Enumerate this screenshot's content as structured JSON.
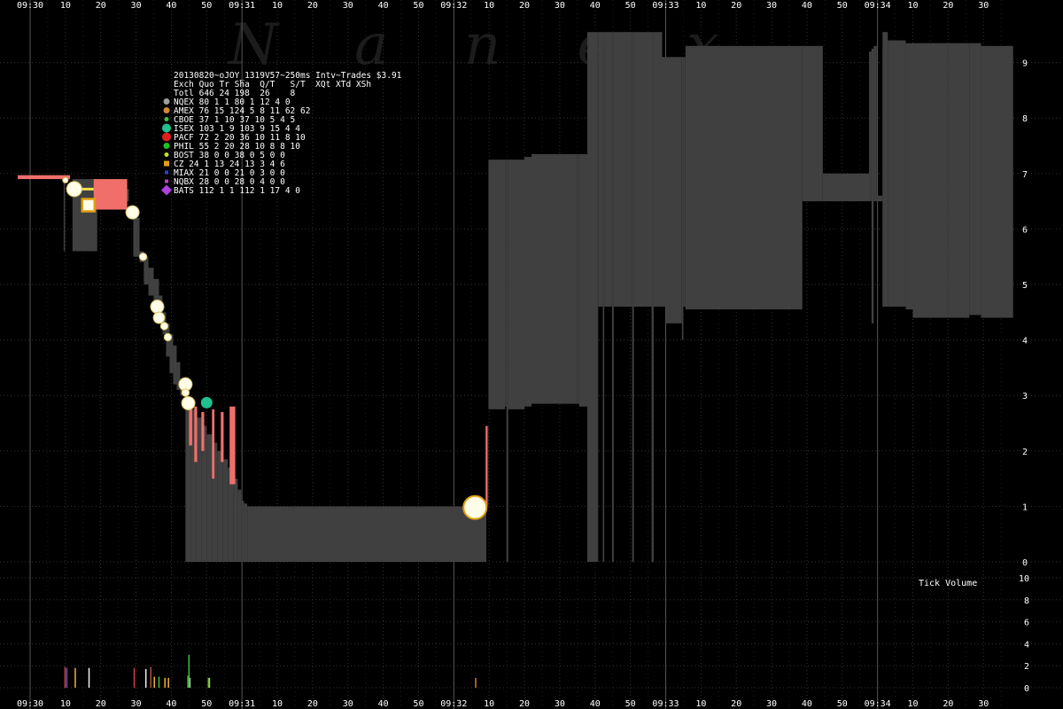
{
  "chart_data": {
    "type": "area",
    "title": "20130820~oJOY_1319V57~250ms Intv~Trades $3.91",
    "watermark": "Nanex",
    "x_axis": {
      "start": "09:30:00",
      "end": "09:34:38",
      "tick_labels": [
        {
          "t": 0,
          "label": "09:30"
        },
        {
          "t": 10,
          "label": "10"
        },
        {
          "t": 20,
          "label": "20"
        },
        {
          "t": 30,
          "label": "30"
        },
        {
          "t": 40,
          "label": "40"
        },
        {
          "t": 50,
          "label": "50"
        },
        {
          "t": 60,
          "label": "09:31"
        },
        {
          "t": 70,
          "label": "10"
        },
        {
          "t": 80,
          "label": "20"
        },
        {
          "t": 90,
          "label": "30"
        },
        {
          "t": 100,
          "label": "40"
        },
        {
          "t": 110,
          "label": "50"
        },
        {
          "t": 120,
          "label": "09:32"
        },
        {
          "t": 130,
          "label": "10"
        },
        {
          "t": 140,
          "label": "20"
        },
        {
          "t": 150,
          "label": "30"
        },
        {
          "t": 160,
          "label": "40"
        },
        {
          "t": 170,
          "label": "50"
        },
        {
          "t": 180,
          "label": "09:33"
        },
        {
          "t": 190,
          "label": "10"
        },
        {
          "t": 200,
          "label": "20"
        },
        {
          "t": 210,
          "label": "30"
        },
        {
          "t": 220,
          "label": "40"
        },
        {
          "t": 230,
          "label": "50"
        },
        {
          "t": 240,
          "label": "09:34"
        },
        {
          "t": 250,
          "label": "10"
        },
        {
          "t": 260,
          "label": "20"
        },
        {
          "t": 270,
          "label": "30"
        }
      ]
    },
    "price_axis": {
      "ylim": [
        0,
        9.5
      ],
      "ticks": [
        0,
        1,
        2,
        3,
        4,
        5,
        6,
        7,
        8,
        9
      ]
    },
    "volume_axis": {
      "label": "Tick Volume",
      "ylim": [
        0,
        10
      ],
      "ticks": [
        0,
        2,
        4,
        6,
        8,
        10
      ]
    },
    "grid": true,
    "colors": {
      "background": "#000000",
      "spread": "#404040",
      "crossed": "#f06f6a",
      "grid": "#333333",
      "minute_line": "#555555",
      "text": "#ffffff"
    },
    "spread_series": [
      {
        "t": 12.0,
        "bid": 5.6,
        "ask": 6.9
      },
      {
        "t": 19.0,
        "bid": 6.5,
        "ask": 6.72
      },
      {
        "t": 28.0,
        "bid": 6.3,
        "ask": 6.35
      },
      {
        "t": 29.2,
        "bid": 5.5,
        "ask": 6.2
      },
      {
        "t": 31.0,
        "bid": 5.4,
        "ask": 5.6
      },
      {
        "t": 32.2,
        "bid": 5.0,
        "ask": 5.5
      },
      {
        "t": 33.5,
        "bid": 4.8,
        "ask": 5.3
      },
      {
        "t": 35.0,
        "bid": 4.5,
        "ask": 5.1
      },
      {
        "t": 36.5,
        "bid": 4.3,
        "ask": 4.8
      },
      {
        "t": 37.5,
        "bid": 4.1,
        "ask": 4.5
      },
      {
        "t": 38.5,
        "bid": 3.7,
        "ask": 4.3
      },
      {
        "t": 39.5,
        "bid": 3.4,
        "ask": 4.1
      },
      {
        "t": 40.5,
        "bid": 3.2,
        "ask": 3.9
      },
      {
        "t": 41.5,
        "bid": 3.1,
        "ask": 3.6
      },
      {
        "t": 42.5,
        "bid": 3.0,
        "ask": 3.3
      },
      {
        "t": 44.0,
        "bid": 0.0,
        "ask": 2.9
      },
      {
        "t": 45.5,
        "bid": 0.0,
        "ask": 2.75
      },
      {
        "t": 47.0,
        "bid": 0.0,
        "ask": 2.6
      },
      {
        "t": 48.5,
        "bid": 0.0,
        "ask": 2.45
      },
      {
        "t": 50.0,
        "bid": 0.0,
        "ask": 2.3
      },
      {
        "t": 51.5,
        "bid": 0.0,
        "ask": 2.15
      },
      {
        "t": 53.0,
        "bid": 0.0,
        "ask": 2.0
      },
      {
        "t": 54.5,
        "bid": 0.0,
        "ask": 1.85
      },
      {
        "t": 56.0,
        "bid": 0.0,
        "ask": 1.7
      },
      {
        "t": 57.5,
        "bid": 0.0,
        "ask": 1.5
      },
      {
        "t": 58.8,
        "bid": 0.0,
        "ask": 1.3
      },
      {
        "t": 59.8,
        "bid": 0.0,
        "ask": 1.1
      },
      {
        "t": 60.6,
        "bid": 0.0,
        "ask": 1.05
      },
      {
        "t": 61.5,
        "bid": 0.0,
        "ask": 1.0
      },
      {
        "t": 128.7,
        "bid": 0.0,
        "ask": 1.0
      },
      {
        "t": 129.2,
        "bid": 1.0,
        "ask": 2.45
      },
      {
        "t": 129.8,
        "bid": 2.75,
        "ask": 7.25
      },
      {
        "t": 134.5,
        "bid": 2.8,
        "ask": 7.25
      },
      {
        "t": 134.9,
        "bid": 0.0,
        "ask": 7.25
      },
      {
        "t": 135.4,
        "bid": 2.75,
        "ask": 7.25
      },
      {
        "t": 140.0,
        "bid": 2.8,
        "ask": 7.3
      },
      {
        "t": 142.0,
        "bid": 2.85,
        "ask": 7.35
      },
      {
        "t": 155.0,
        "bid": 2.85,
        "ask": 7.35
      },
      {
        "t": 155.5,
        "bid": 2.8,
        "ask": 7.35
      },
      {
        "t": 157.8,
        "bid": 0.0,
        "ask": 9.55
      },
      {
        "t": 160.7,
        "bid": 0.0,
        "ask": 9.55
      },
      {
        "t": 160.9,
        "bid": 4.6,
        "ask": 9.55
      },
      {
        "t": 162.2,
        "bid": 0.0,
        "ask": 9.55
      },
      {
        "t": 162.6,
        "bid": 4.6,
        "ask": 9.55
      },
      {
        "t": 164.8,
        "bid": 0.0,
        "ask": 9.55
      },
      {
        "t": 165.3,
        "bid": 4.6,
        "ask": 9.55
      },
      {
        "t": 170.5,
        "bid": 0.0,
        "ask": 9.55
      },
      {
        "t": 171.0,
        "bid": 4.6,
        "ask": 9.55
      },
      {
        "t": 176.0,
        "bid": 0.0,
        "ask": 9.55
      },
      {
        "t": 176.6,
        "bid": 4.6,
        "ask": 9.55
      },
      {
        "t": 179.0,
        "bid": 4.6,
        "ask": 9.1
      },
      {
        "t": 180.0,
        "bid": 4.3,
        "ask": 9.1
      },
      {
        "t": 184.6,
        "bid": 4.0,
        "ask": 9.1
      },
      {
        "t": 185.0,
        "bid": 4.6,
        "ask": 9.1
      },
      {
        "t": 185.6,
        "bid": 4.55,
        "ask": 9.3
      },
      {
        "t": 218.7,
        "bid": 6.5,
        "ask": 9.3
      },
      {
        "t": 224.5,
        "bid": 6.5,
        "ask": 7.0
      },
      {
        "t": 237.6,
        "bid": 6.5,
        "ask": 9.2
      },
      {
        "t": 238.3,
        "bid": 4.3,
        "ask": 9.25
      },
      {
        "t": 238.9,
        "bid": 6.5,
        "ask": 9.3
      },
      {
        "t": 239.8,
        "bid": 6.5,
        "ask": 6.6
      },
      {
        "t": 241.4,
        "bid": 4.6,
        "ask": 9.55
      },
      {
        "t": 242.9,
        "bid": 4.6,
        "ask": 9.4
      },
      {
        "t": 248.0,
        "bid": 4.55,
        "ask": 9.35
      },
      {
        "t": 250.0,
        "bid": 4.4,
        "ask": 9.35
      },
      {
        "t": 260.0,
        "bid": 4.4,
        "ask": 9.35
      },
      {
        "t": 266.0,
        "bid": 4.45,
        "ask": 9.35
      },
      {
        "t": 269.3,
        "bid": 4.4,
        "ask": 9.3
      },
      {
        "t": 278.4,
        "bid": 4.4,
        "ask": 9.3
      }
    ],
    "crossed_bars": [
      {
        "t0": -3.5,
        "t1": 11.3,
        "lo": 6.9,
        "hi": 6.97
      },
      {
        "t0": 18.0,
        "t1": 27.5,
        "lo": 6.35,
        "hi": 6.9
      },
      {
        "t0": 45.0,
        "t1": 45.9,
        "lo": 2.1,
        "hi": 2.9
      },
      {
        "t0": 46.5,
        "t1": 47.3,
        "lo": 1.8,
        "hi": 2.8
      },
      {
        "t0": 48.5,
        "t1": 49.3,
        "lo": 2.0,
        "hi": 2.7
      },
      {
        "t0": 51.5,
        "t1": 52.2,
        "lo": 1.5,
        "hi": 2.75
      },
      {
        "t0": 54.0,
        "t1": 54.8,
        "lo": 1.8,
        "hi": 2.7
      },
      {
        "t0": 56.5,
        "t1": 58.1,
        "lo": 1.4,
        "hi": 2.8
      },
      {
        "t0": 129.0,
        "t1": 129.5,
        "lo": 1.0,
        "hi": 2.45
      }
    ],
    "trades": [
      {
        "t": 10.0,
        "price": 6.88,
        "exch": "NQEX",
        "size": 1
      },
      {
        "t": 12.5,
        "price": 6.72,
        "exch": "NQEX",
        "size": 6
      },
      {
        "t": 16.5,
        "price": 6.43,
        "exch": "CZ",
        "size": 6
      },
      {
        "t": 29.0,
        "price": 6.3,
        "exch": "NQEX",
        "size": 5
      },
      {
        "t": 32.0,
        "price": 5.5,
        "exch": "NQEX",
        "size": 2
      },
      {
        "t": 36.0,
        "price": 4.6,
        "exch": "NQEX",
        "size": 5
      },
      {
        "t": 36.5,
        "price": 4.4,
        "exch": "NQEX",
        "size": 4
      },
      {
        "t": 38.0,
        "price": 4.25,
        "exch": "NQEX",
        "size": 2
      },
      {
        "t": 39.0,
        "price": 4.05,
        "exch": "NQEX",
        "size": 2
      },
      {
        "t": 44.0,
        "price": 3.2,
        "exch": "NQEX",
        "size": 5
      },
      {
        "t": 44.0,
        "price": 3.05,
        "exch": "NQEX",
        "size": 2
      },
      {
        "t": 44.5,
        "price": 2.88,
        "exch": "CBOE",
        "size": 5
      },
      {
        "t": 44.8,
        "price": 2.86,
        "exch": "NQEX",
        "size": 5
      },
      {
        "t": 50.0,
        "price": 2.87,
        "exch": "ISEX",
        "size": 5
      },
      {
        "t": 126.0,
        "price": 0.98,
        "exch": "NQEX",
        "size": 10
      }
    ],
    "volume_bars": [
      {
        "t": 9.7,
        "v": 1.9,
        "color": "#b0503c"
      },
      {
        "t": 10.2,
        "v": 1.8,
        "color": "#8e44ad"
      },
      {
        "t": 12.6,
        "v": 1.8,
        "color": "#f0b030"
      },
      {
        "t": 16.5,
        "v": 1.8,
        "color": "#f0f0f0"
      },
      {
        "t": 29.3,
        "v": 1.8,
        "color": "#d04040"
      },
      {
        "t": 32.6,
        "v": 1.7,
        "color": "#f0f0f0"
      },
      {
        "t": 34.0,
        "v": 1.9,
        "color": "#b0503c"
      },
      {
        "t": 35.0,
        "v": 1.0,
        "color": "#f0b030"
      },
      {
        "t": 36.3,
        "v": 1.0,
        "color": "#40c040"
      },
      {
        "t": 38.0,
        "v": 0.9,
        "color": "#f0b030"
      },
      {
        "t": 39.0,
        "v": 0.9,
        "color": "#f0b030"
      },
      {
        "t": 44.5,
        "v": 1.1,
        "color": "#40c040"
      },
      {
        "t": 44.8,
        "v": 3.0,
        "color": "#40c040"
      },
      {
        "t": 45.1,
        "v": 0.9,
        "color": "#b0b0b0"
      },
      {
        "t": 50.3,
        "v": 0.9,
        "color": "#40c040"
      },
      {
        "t": 50.6,
        "v": 0.9,
        "color": "#f0b030"
      },
      {
        "t": 126.0,
        "v": 0.9,
        "color": "#d08030"
      }
    ]
  },
  "legend": {
    "title": "20130820~oJOY_1319V57~250ms Intv~Trades $3.91",
    "header": "Exch Quo Tr Sha  Q/T   S/T  XQt XTd XSh",
    "total": "Totl 646 24 198  26    8",
    "rows": [
      {
        "name": "NQEX",
        "text": "NQEX  80  1  1    80     1  12   4   0",
        "color": "#a0a0a0",
        "shape": "circle"
      },
      {
        "name": "AMEX",
        "text": "AMEX  76 15 124    5     8  11  62  62",
        "color": "#d08a30",
        "shape": "circle"
      },
      {
        "name": "CBOE",
        "text": "CBOE  37  1  10   37    10   5   4   5",
        "color": "#40c040",
        "shape": "circle-small"
      },
      {
        "name": "ISEX",
        "text": "ISEX 103  1   9  103     9  15   4   4",
        "color": "#20c090",
        "shape": "circle-large"
      },
      {
        "name": "PACF",
        "text": "PACF  72  2  20   36    10  11   8  10",
        "color": "#e02020",
        "shape": "circle-large"
      },
      {
        "name": "PHIL",
        "text": "PHIL  55  2  20   28    10   8   8  10",
        "color": "#20c020",
        "shape": "circle"
      },
      {
        "name": "BOST",
        "text": "BOST  38  0   0   38     0   5   0   0",
        "color": "#c0e020",
        "shape": "circle-small"
      },
      {
        "name": "CZ",
        "text": "  CZ  24  1  13   24    13   3   4   6",
        "color": "#e0a010",
        "shape": "square"
      },
      {
        "name": "MIAX",
        "text": "MIAX  21  0   0   21     0   3   0   0",
        "color": "#3040d0",
        "shape": "square-small"
      },
      {
        "name": "NQBX",
        "text": "NQBX  28  0   0   28     0   4   0   0",
        "color": "#c040c0",
        "shape": "square-small"
      },
      {
        "name": "BATS",
        "text": "BATS 112  1   1  112     1  17   4   0",
        "color": "#b040e0",
        "shape": "diamond"
      }
    ]
  }
}
